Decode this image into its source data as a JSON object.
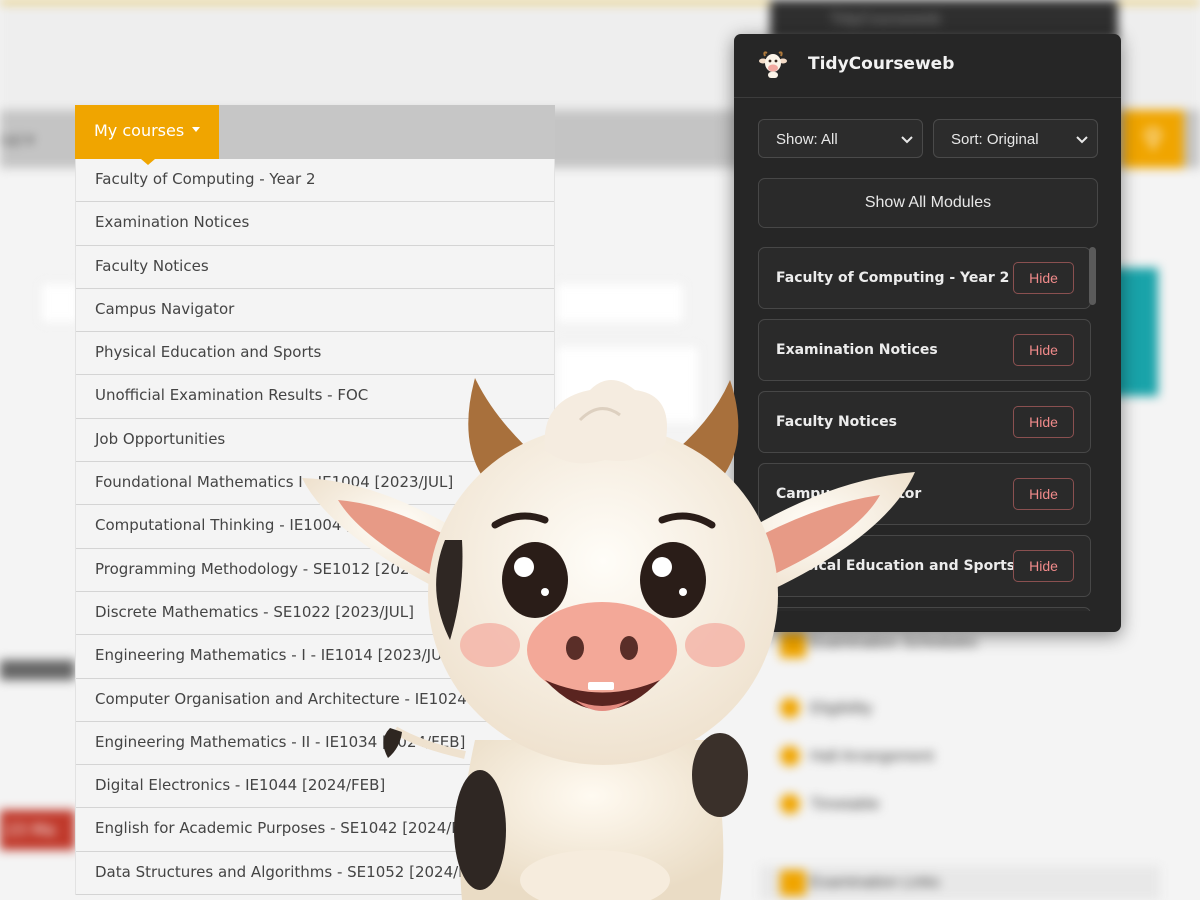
{
  "background": {
    "nav_label": "nal ▾",
    "ext_strip_title": "TidyCourseweb",
    "red_badge": "23 Ma",
    "side_links": [
      "Eligibility",
      "Hall Arrangement",
      "Timetable"
    ],
    "section_schedules": "Examination Schedules",
    "section_links": "Examination Links"
  },
  "courses_menu": {
    "label": "My courses",
    "items": [
      "Faculty of Computing - Year 2",
      "Examination Notices",
      "Faculty Notices",
      "Campus Navigator",
      "Physical Education and Sports",
      "Unofficial Examination Results - FOC",
      "Job Opportunities",
      "Foundational Mathematics I - IE1004 [2023/JUL]",
      "Computational Thinking - IE1004 [2023/JUL]",
      "Programming Methodology - SE1012 [2023/JUL]",
      "Discrete Mathematics - SE1022 [2023/JUL]",
      "Engineering Mathematics - I - IE1014 [2023/JUL]",
      "Computer Organisation and Architecture - IE1024 [2023/JUL]",
      "Engineering Mathematics - II - IE1034 [2024/FEB]",
      "Digital Electronics - IE1044 [2024/FEB]",
      "English for Academic Purposes - SE1042 [2024/FEB]",
      "Data Structures and Algorithms - SE1052 [2024/FEB]"
    ]
  },
  "extension": {
    "title": "TidyCourseweb",
    "show_filter": "Show: All",
    "sort_filter": "Sort: Original",
    "show_all_label": "Show All Modules",
    "hide_label": "Hide",
    "modules": [
      "Faculty of Computing - Year 2",
      "Examination Notices",
      "Faculty Notices",
      "Campus Navigator",
      "Physical Education and Sports"
    ]
  },
  "colors": {
    "accent_orange": "#f0a500",
    "popup_bg": "#262626",
    "hide_text": "#f08a8a",
    "teal": "#19a3a9"
  }
}
